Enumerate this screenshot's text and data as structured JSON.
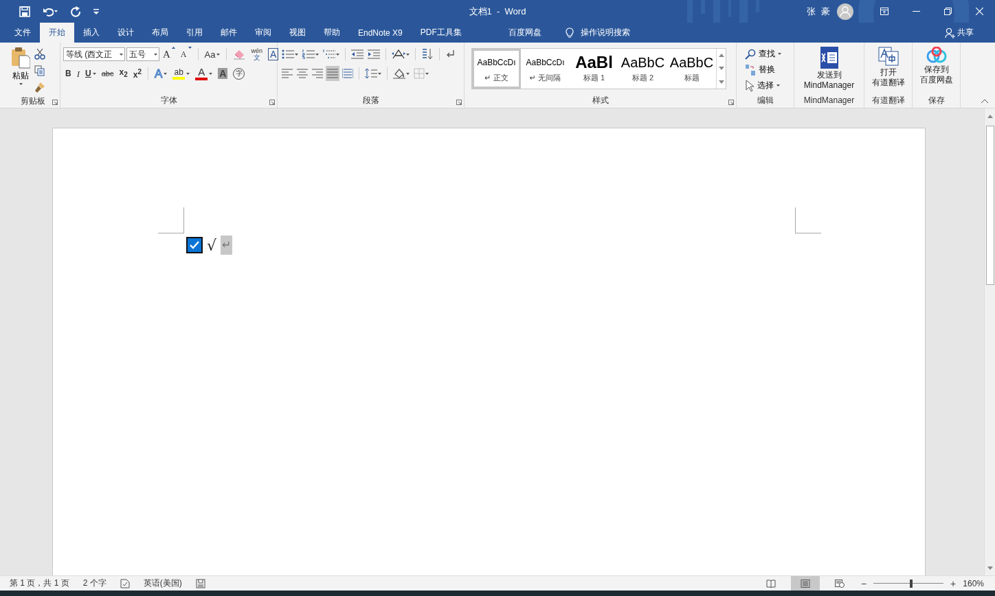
{
  "title_bar": {
    "title": "文档1  -  Word",
    "user": "张 豪"
  },
  "tabs": [
    {
      "label": "文件",
      "selected": false
    },
    {
      "label": "开始",
      "selected": true
    },
    {
      "label": "插入",
      "selected": false
    },
    {
      "label": "设计",
      "selected": false
    },
    {
      "label": "布局",
      "selected": false
    },
    {
      "label": "引用",
      "selected": false
    },
    {
      "label": "邮件",
      "selected": false
    },
    {
      "label": "审阅",
      "selected": false
    },
    {
      "label": "视图",
      "selected": false
    },
    {
      "label": "帮助",
      "selected": false
    },
    {
      "label": "EndNote X9",
      "selected": false
    },
    {
      "label": "PDF工具集",
      "selected": false
    },
    {
      "label": "百度网盘",
      "selected": false
    }
  ],
  "tell_me": "操作说明搜索",
  "share": "共享",
  "clipboard": {
    "paste": "粘贴",
    "label": "剪贴板"
  },
  "font": {
    "name": "等线 (西文正",
    "size": "五号",
    "label": "字体",
    "row1": [
      {
        "kind": "grow",
        "label": "A"
      },
      {
        "kind": "shrink",
        "label": "A"
      },
      {
        "kind": "case",
        "label": "Aa",
        "dropdown": true
      },
      {
        "kind": "clear"
      },
      {
        "kind": "phonetic",
        "label": "文",
        "ruby": "wén"
      },
      {
        "kind": "border",
        "label": "A"
      }
    ],
    "row2": [
      {
        "kind": "bold",
        "label": "B"
      },
      {
        "kind": "italic",
        "label": "I"
      },
      {
        "kind": "underline",
        "label": "U",
        "dropdown": true
      },
      {
        "kind": "strike",
        "label": "abc"
      },
      {
        "kind": "sub",
        "label": "x$_{2}$"
      },
      {
        "kind": "sup",
        "label": "x$^{2}$"
      },
      {
        "kind": "effect",
        "label": "A",
        "dropdown": true
      },
      {
        "kind": "highlight",
        "label": "ab",
        "dropdown": true
      },
      {
        "kind": "color",
        "label": "A",
        "dropdown": true
      },
      {
        "kind": "shade",
        "label": "A"
      },
      {
        "kind": "enclose",
        "label": "字"
      }
    ]
  },
  "paragraph": {
    "label": "段落",
    "alignments": [
      {
        "selected": false
      },
      {
        "selected": false
      },
      {
        "selected": false
      },
      {
        "selected": true
      },
      {
        "selected": false
      }
    ]
  },
  "styles": {
    "label": "样式",
    "items": [
      {
        "preview": "AaBbCcDı",
        "name": "正文",
        "mark": "↵",
        "kind": "body",
        "selected": true
      },
      {
        "preview": "AaBbCcDı",
        "name": "无间隔",
        "mark": "↵",
        "kind": "body",
        "selected": false
      },
      {
        "preview": "AaBl",
        "name": "标题 1",
        "kind": "h1",
        "selected": false
      },
      {
        "preview": "AaBbC",
        "name": "标题 2",
        "kind": "h2",
        "selected": false
      },
      {
        "preview": "AaBbC",
        "name": "标题",
        "kind": "title",
        "selected": false
      }
    ]
  },
  "editing": {
    "label": "编辑",
    "items": [
      {
        "label": "查找",
        "kind": "find",
        "dropdown": true
      },
      {
        "label": "替换",
        "kind": "replace",
        "dropdown": false
      },
      {
        "label": "选择",
        "kind": "select",
        "dropdown": true
      }
    ]
  },
  "addins": [
    {
      "button": [
        "发送到",
        "MindManager"
      ],
      "label": "MindManager",
      "kind": "mindmanager"
    },
    {
      "button": [
        "打开",
        "有道翻译"
      ],
      "label": "有道翻译",
      "kind": "youdao"
    },
    {
      "button": [
        "保存到",
        "百度网盘"
      ],
      "label": "保存",
      "kind": "baidu"
    }
  ],
  "document": {
    "checkbox": {
      "checked": true
    },
    "text": "√",
    "paragraph_mark": "↵",
    "mark_selected": true
  },
  "status_bar": {
    "page": "第 1 页，共 1 页",
    "words": "2 个字",
    "language": "英语(美国)",
    "views": [
      {
        "selected": false
      },
      {
        "selected": true
      },
      {
        "selected": false
      }
    ],
    "zoom_minus": "−",
    "zoom_plus": "+",
    "zoom": {
      "level": 0.55
    },
    "zoom_text": "160%"
  }
}
